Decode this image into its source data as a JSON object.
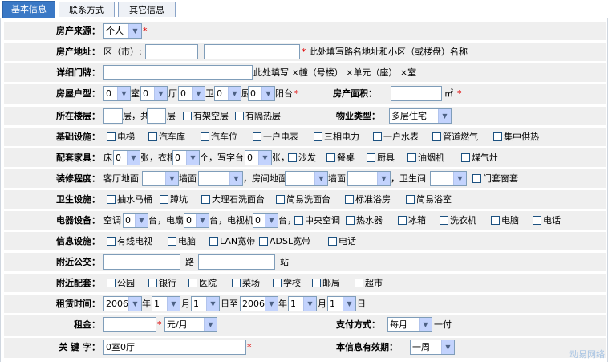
{
  "tabs": [
    "基本信息",
    "联系方式",
    "其它信息"
  ],
  "star": "*",
  "source": {
    "label": "房产来源：",
    "value": "个人"
  },
  "address": {
    "label": "房产地址：",
    "district": "区（市）:",
    "note": "此处填写路名地址和小区（或楼盘）名称"
  },
  "door": {
    "label": "详细门牌：",
    "note": "此处填写 ×幢（号楼） ×单元（座） ×室"
  },
  "layout": {
    "label": "房屋户型：",
    "rooms": "0",
    "rooms_unit": "室",
    "halls": "0",
    "halls_unit": "厅",
    "baths": "0",
    "baths_unit": "卫",
    "kitchens": "0",
    "kitchens_unit": "厨",
    "balconies": "0",
    "balconies_unit": "阳台"
  },
  "area": {
    "label": "房产面积：",
    "unit": "㎡"
  },
  "floor": {
    "label": "所在楼层：",
    "floor_unit": "层，共",
    "total_unit": "层",
    "options": [
      "有架空层",
      "有隔热层"
    ]
  },
  "type": {
    "label": "物业类型：",
    "value": "多层住宅"
  },
  "facilities": {
    "label": "基础设施：",
    "options": [
      "电梯",
      "汽车库",
      "汽车位",
      "一户电表",
      "三相电力",
      "一户水表",
      "管道燃气",
      "集中供热"
    ]
  },
  "furniture": {
    "label": "配套家具：",
    "bed": "床",
    "bed_val": "0",
    "bed_unit": "张，衣柜",
    "wardrobe_val": "0",
    "wardrobe_unit": "个，写字台",
    "desk_val": "0",
    "desk_unit": "张，",
    "options": [
      "沙发",
      "餐桌",
      "厨具",
      "油烟机",
      "煤气灶"
    ]
  },
  "decoration": {
    "label": "装修程度：",
    "hall_floor": "客厅地面",
    "hall_wall": "墙面",
    "room_floor": "，房间地面",
    "room_wall": "墙面",
    "bathroom": "，卫生间",
    "door_opt": "门套窗套"
  },
  "sanitary": {
    "label": "卫生设施：",
    "options": [
      "抽水马桶",
      "蹲坑",
      "大理石洗面台",
      "简易洗面台",
      "标准浴房",
      "简易浴室"
    ]
  },
  "appliances": {
    "label": "电器设备：",
    "ac": "空调",
    "ac_val": "0",
    "ac_unit": "台，电扇",
    "fan_val": "0",
    "fan_unit": "台，电视机",
    "tv_val": "0",
    "tv_unit": "台，",
    "options": [
      "中央空调",
      "热水器",
      "冰箱",
      "洗衣机",
      "电脑",
      "电话"
    ]
  },
  "info": {
    "label": "信息设施：",
    "options": [
      "有线电视",
      "电脑",
      "LAN宽带",
      "ADSL宽带",
      "电话"
    ]
  },
  "transit": {
    "label": "附近公交：",
    "road": "路",
    "station": "站"
  },
  "nearby": {
    "label": "附近配套：",
    "options": [
      "公园",
      "银行",
      "医院",
      "菜场",
      "学校",
      "邮局",
      "超市"
    ]
  },
  "lease": {
    "label": "租赁时间：",
    "y1": "2006",
    "year": "年",
    "m1": "1",
    "month": "月",
    "d1": "1",
    "day_to": "日至",
    "y2": "2006",
    "m2": "1",
    "d2": "1",
    "day": "日"
  },
  "rent": {
    "label": "租金：",
    "unit": "元/月"
  },
  "payment": {
    "label": "支付方式：",
    "value": "每月",
    "suffix": "一付"
  },
  "keywords": {
    "label": "关 键 字：",
    "value": "0室0厅"
  },
  "validity": {
    "label": "本信息有效期：",
    "value": "一周"
  },
  "watermark": "动易网络"
}
